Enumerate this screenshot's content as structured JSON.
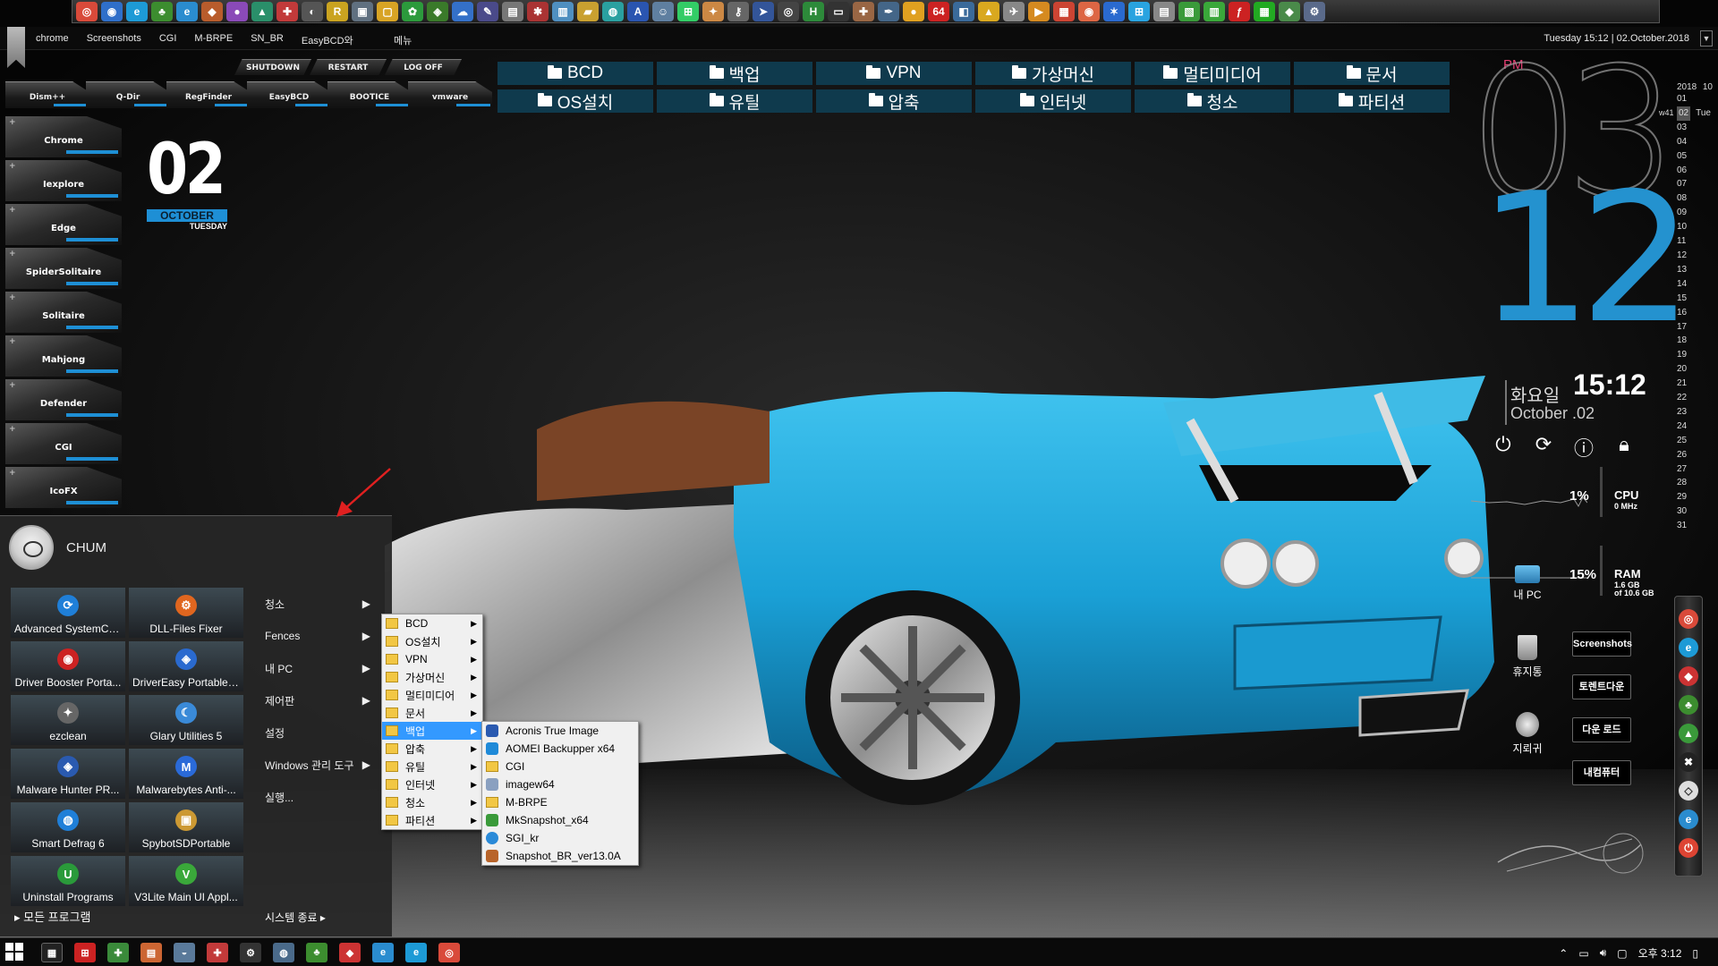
{
  "topbar": {
    "links": [
      "chrome",
      "Screenshots",
      "CGI",
      "M-BRPE",
      "SN_BR",
      "EasyBCD와"
    ],
    "menu_label": "메뉴",
    "datetime": "Tuesday 15:12 | 02.October.2018"
  },
  "power_tabs": [
    "SHUTDOWN",
    "RESTART",
    "LOG OFF"
  ],
  "launch_tabs": [
    "Dism++",
    "Q-Dir",
    "RegFinder",
    "EasyBCD",
    "BOOTICE",
    "vmware"
  ],
  "left_apps": [
    "Chrome",
    "Iexplore",
    "Edge",
    "SpiderSolitaire",
    "Solitaire",
    "Mahjong",
    "Defender",
    "CGI",
    "IcoFX"
  ],
  "date_widget": {
    "day": "02",
    "month": "OCTOBER",
    "weekday": "TUESDAY"
  },
  "fences": [
    "BCD",
    "백업",
    "VPN",
    "가상머신",
    "멀티미디어",
    "문서",
    "OS설치",
    "유틸",
    "압축",
    "인터넷",
    "청소",
    "파티션"
  ],
  "clock": {
    "ampm": "PM",
    "hour": "03",
    "minute": "12",
    "weekday_kr": "화요일",
    "time": "15:12",
    "date": "October .02"
  },
  "calendar": {
    "year": "2018",
    "month": "10",
    "week": "w41",
    "today": "02",
    "today_dow": "Tue",
    "days": [
      "01",
      "02",
      "03",
      "04",
      "05",
      "06",
      "07",
      "08",
      "09",
      "10",
      "11",
      "12",
      "13",
      "14",
      "15",
      "16",
      "17",
      "18",
      "19",
      "20",
      "21",
      "22",
      "23",
      "24",
      "25",
      "26",
      "27",
      "28",
      "29",
      "30",
      "31"
    ]
  },
  "meters": {
    "cpu": {
      "pct": "1%",
      "label": "CPU",
      "sub": "0 MHz"
    },
    "ram": {
      "pct": "15%",
      "label": "RAM",
      "sub1": "1.6 GB",
      "sub2": "of 10.6 GB"
    }
  },
  "desktop_icons": [
    "내 PC",
    "휴지통",
    "지뢰귀"
  ],
  "fence_links": [
    "Screenshots",
    "토렌트다운",
    "다운 로드",
    "내컴퓨터"
  ],
  "start_menu": {
    "user": "CHUM",
    "tiles": [
      "Advanced SystemCa...",
      "DLL-Files Fixer",
      "Driver Booster Porta...",
      "DriverEasy Portable ...",
      "ezclean",
      "Glary Utilities 5",
      "Malware Hunter PR...",
      "Malwarebytes Anti-...",
      "Smart Defrag 6",
      "SpybotSDPortable",
      "Uninstall Programs",
      "V3Lite Main UI Appl..."
    ],
    "all_programs": "모든 프로그램",
    "right_items": [
      "청소",
      "Fences",
      "내 PC",
      "제어판",
      "설정",
      "Windows 관리 도구",
      "실행..."
    ],
    "shutdown": "시스템 종료"
  },
  "submenu1": [
    "BCD",
    "OS설치",
    "VPN",
    "가상머신",
    "멀티미디어",
    "문서",
    "백업",
    "압축",
    "유틸",
    "인터넷",
    "청소",
    "파티션"
  ],
  "submenu2": [
    "Acronis True Image",
    "AOMEI Backupper x64",
    "CGI",
    "imagew64",
    "M-BRPE",
    "MkSnapshot_x64",
    "SGI_kr",
    "Snapshot_BR_ver13.0A"
  ],
  "tray": {
    "time": "오후 3:12"
  },
  "colors": {
    "accent": "#1e8fd5",
    "fence_bg": "#0f3a4d",
    "minute": "#2492cf",
    "pm": "#e63e73"
  }
}
